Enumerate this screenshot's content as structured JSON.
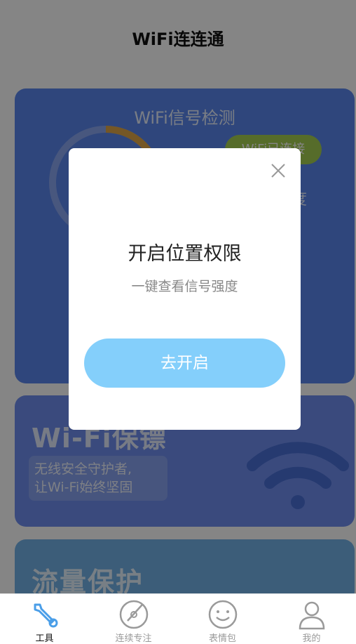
{
  "app": {
    "title": "WiFi连连通"
  },
  "cards": {
    "wifi_check": {
      "title": "WiFi信号检测",
      "status": "WiFi已连接",
      "side_text": "度"
    },
    "wifi_guard": {
      "title": "Wi-Fi保镖",
      "subtitle_line1": "无线安全守护者,",
      "subtitle_line2": "让Wi-Fi始终坚固"
    },
    "traffic": {
      "title": "流量保护"
    }
  },
  "dialog": {
    "title": "开启位置权限",
    "subtitle": "一键查看信号强度",
    "button_label": "去开启"
  },
  "tabbar": {
    "items": [
      {
        "label": "工具",
        "icon": "wrench-icon",
        "active": true
      },
      {
        "label": "连续专注",
        "icon": "compass-icon",
        "active": false
      },
      {
        "label": "表情包",
        "icon": "smiley-icon",
        "active": false
      },
      {
        "label": "我的",
        "icon": "person-icon",
        "active": false
      }
    ]
  },
  "colors": {
    "accent_blue": "#4a9ee8",
    "dialog_button": "#84cffb",
    "status_green": "#a6cf52",
    "card_blue": "#5b86ee"
  }
}
